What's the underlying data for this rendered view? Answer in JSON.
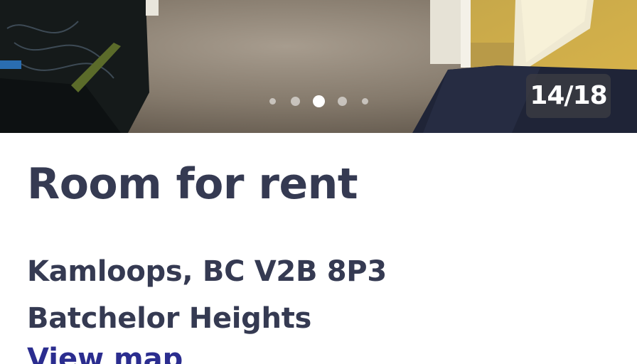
{
  "gallery": {
    "counter": "14/18",
    "current_index": 14,
    "total": 18
  },
  "listing": {
    "title": "Room for rent",
    "address": "Kamloops, BC V2B 8P3",
    "neighborhood": "Batchelor Heights",
    "view_map_label": "View map"
  },
  "colors": {
    "text_dark": "#353a52",
    "link": "#2b2d8f",
    "counter_bg": "#3c3c42"
  },
  "icons": {
    "pagination": "dot-indicators"
  }
}
